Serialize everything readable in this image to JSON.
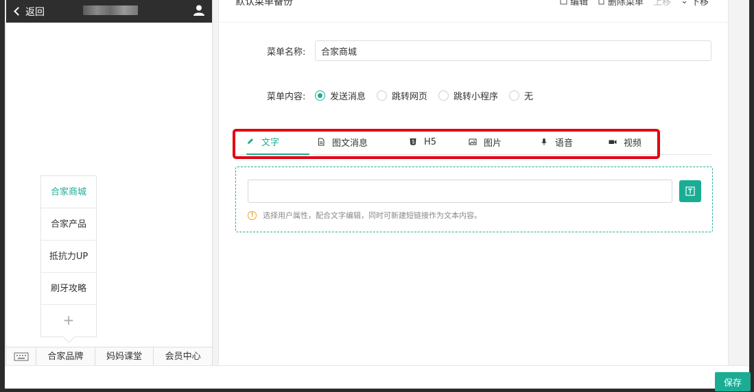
{
  "phone": {
    "back_label": "返回",
    "submenu": [
      {
        "label": "合家商城",
        "active": true
      },
      {
        "label": "合家产品",
        "active": false
      },
      {
        "label": "抵抗力UP",
        "active": false
      },
      {
        "label": "刷牙攻略",
        "active": false
      }
    ],
    "add_label": "+",
    "bottom_menus": [
      "合家品牌",
      "妈妈课堂",
      "会员中心"
    ]
  },
  "panel": {
    "title": "默认菜单备份",
    "actions": {
      "edit": "编辑",
      "delete": "删除菜单",
      "move_up": "上移",
      "move_down": "下移"
    },
    "name_label": "菜单名称:",
    "name_value": "合家商城",
    "content_label": "菜单内容:",
    "content_options": [
      "发送消息",
      "跳转网页",
      "跳转小程序",
      "无"
    ],
    "content_selected": "发送消息",
    "tabs": [
      {
        "label": "文字",
        "icon": "pencil-icon"
      },
      {
        "label": "图文消息",
        "icon": "document-icon"
      },
      {
        "label": "H5",
        "icon": "html5-icon"
      },
      {
        "label": "图片",
        "icon": "image-icon"
      },
      {
        "label": "语音",
        "icon": "microphone-icon"
      },
      {
        "label": "视频",
        "icon": "video-icon"
      }
    ],
    "active_tab": "文字",
    "hint": "选择用户属性，配合文字编辑，同时可新建短链接作为文本内容。"
  },
  "save_label": "保存",
  "colors": {
    "accent": "#1aad94",
    "highlight": "#e3000f",
    "header_dark": "#2e2e2e"
  }
}
